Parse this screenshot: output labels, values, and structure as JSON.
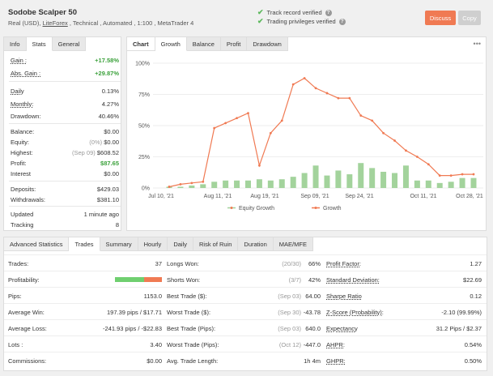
{
  "header": {
    "title": "Sodobe Scalper 50",
    "sub_prefix": "Real (USD), ",
    "broker": "LiteForex",
    "sub_suffix": " , Technical , Automated , 1:100 , MetaTrader 4",
    "verify1": "Track record verified",
    "verify2": "Trading privileges verified",
    "discuss": "Discuss",
    "copy": "Copy"
  },
  "info_tabs": [
    "Info",
    "Stats",
    "General"
  ],
  "info": {
    "gain_k": "Gain :",
    "gain_v": "+17.58%",
    "absgain_k": "Abs. Gain :",
    "absgain_v": "+29.87%",
    "daily_k": "Daily",
    "daily_v": "0.13%",
    "monthly_k": "Monthly:",
    "monthly_v": "4.27%",
    "drawdown_k": "Drawdown:",
    "drawdown_v": "40.46%",
    "balance_k": "Balance:",
    "balance_v": "$0.00",
    "equity_k": "Equity:",
    "equity_pre": "(0%)",
    "equity_v": "$0.00",
    "highest_k": "Highest:",
    "highest_pre": "(Sep 09)",
    "highest_v": "$608.52",
    "profit_k": "Profit:",
    "profit_v": "$87.65",
    "interest_k": "Interest",
    "interest_v": "$0.00",
    "deposits_k": "Deposits:",
    "deposits_v": "$429.03",
    "withdrawals_k": "Withdrawals:",
    "withdrawals_v": "$381.10",
    "updated_k": "Updated",
    "updated_v": "1 minute ago",
    "tracking_k": "Tracking",
    "tracking_v": "8"
  },
  "chart_tabs": [
    "Chart",
    "Growth",
    "Balance",
    "Profit",
    "Drawdown"
  ],
  "chart_menu": "•••",
  "chart_data": {
    "type": "line",
    "title": "",
    "y_ticks": [
      "100%",
      "75%",
      "50%",
      "25%",
      "0%"
    ],
    "ylim": [
      0,
      100
    ],
    "x_ticks": [
      "Jul 10, '21",
      "Aug 11, '21",
      "Aug 19, '21",
      "Sep 09, '21",
      "Sep 24, '21",
      "Oct 11, '21",
      "Oct 28, '21"
    ],
    "series": [
      {
        "name": "Equity Growth",
        "type": "bar",
        "color": "#a3d39c",
        "values": [
          1,
          1,
          2,
          3,
          5,
          6,
          6,
          6,
          7,
          6,
          7,
          9,
          12,
          18,
          10,
          14,
          11,
          20,
          16,
          13,
          12,
          18,
          6,
          6,
          4,
          5,
          8,
          8
        ]
      },
      {
        "name": "Growth",
        "type": "line",
        "color": "#f07a53",
        "values": [
          1,
          3,
          4,
          5,
          48,
          52,
          56,
          60,
          18,
          44,
          54,
          83,
          88,
          80,
          76,
          72,
          72,
          58,
          54,
          44,
          38,
          30,
          25,
          19,
          10,
          10,
          11,
          11
        ]
      }
    ],
    "legend": [
      "Equity Growth",
      "Growth"
    ],
    "legend_position": "bottom"
  },
  "stats_tabs": [
    "Advanced Statistics",
    "Trades",
    "Summary",
    "Hourly",
    "Daily",
    "Risk of Ruin",
    "Duration",
    "MAE/MFE"
  ],
  "stats": {
    "r1": {
      "k1": "Trades:",
      "v1": "37",
      "k2": "Longs Won:",
      "m2": "(20/30)",
      "v2": "66%",
      "k3": "Profit Factor:",
      "v3": "1.27"
    },
    "r2": {
      "k1": "Profitability:",
      "k2": "Shorts Won:",
      "m2": "(3/7)",
      "v2": "42%",
      "k3": "Standard Deviation:",
      "v3": "$22.69"
    },
    "r3": {
      "k1": "Pips:",
      "v1": "1153.0",
      "k2": "Best Trade ($):",
      "m2": "(Sep 03)",
      "v2": "64.00",
      "k3": "Sharpe Ratio",
      "v3": "0.12"
    },
    "r4": {
      "k1": "Average Win:",
      "v1": "197.39 pips / $17.71",
      "k2": "Worst Trade ($):",
      "m2": "(Sep 30)",
      "v2": "-43.78",
      "k3": "Z-Score (Probability):",
      "v3": "-2.10 (99.99%)"
    },
    "r5": {
      "k1": "Average Loss:",
      "v1": "-241.93 pips / -$22.83",
      "k2": "Best Trade (Pips):",
      "m2": "(Sep 03)",
      "v2": "640.0",
      "k3": "Expectancy",
      "v3": "31.2 Pips / $2.37"
    },
    "r6": {
      "k1": "Lots :",
      "v1": "3.40",
      "k2": "Worst Trade (Pips):",
      "m2": "(Oct 12)",
      "v2": "-447.0",
      "k3": "AHPR:",
      "v3": "0.54%"
    },
    "r7": {
      "k1": "Commissions:",
      "v1": "$0.00",
      "k2": "Avg. Trade Length:",
      "v2": "1h 4m",
      "k3": "GHPR:",
      "v3": "0.50%"
    }
  },
  "profitability": {
    "win_fraction": 0.62,
    "win_color": "#6fcf6f",
    "loss_color": "#f07a53"
  }
}
